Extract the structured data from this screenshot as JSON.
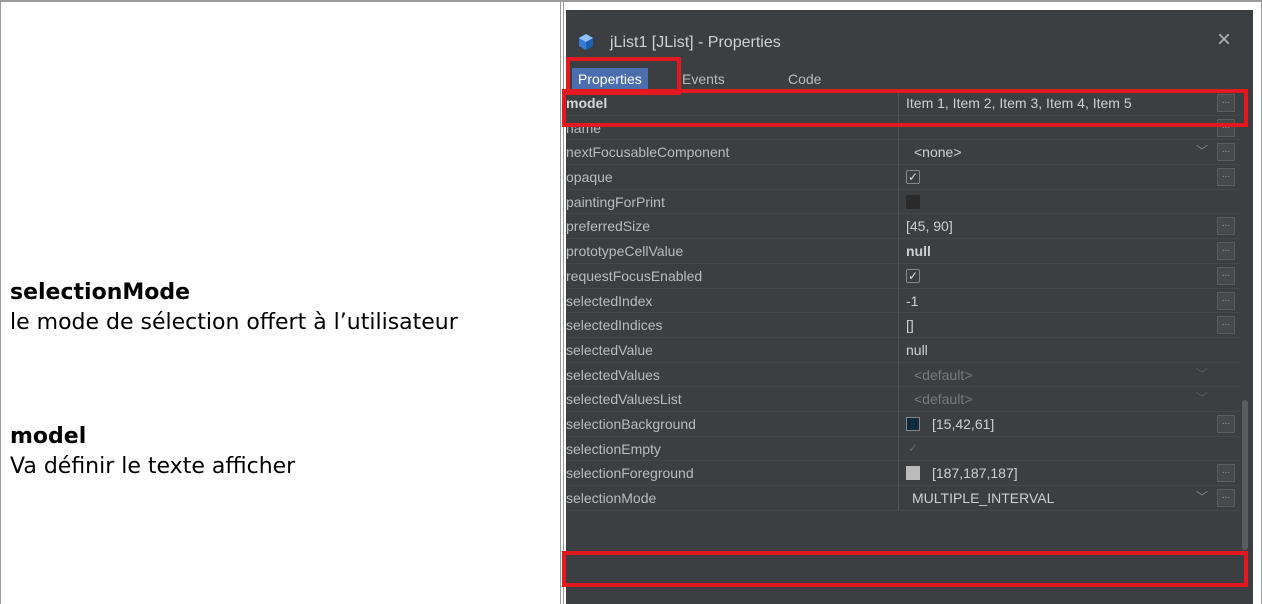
{
  "doc": {
    "heading1": "selectionMode",
    "desc1": "le mode de sélection offert à l’utilisateur",
    "heading2": "model",
    "desc2": "Va définir le texte afficher"
  },
  "window": {
    "title": "jList1 [JList] - Properties",
    "close": "×",
    "tabs": [
      "Properties",
      "Events",
      "Code"
    ]
  },
  "properties": [
    {
      "name": "model",
      "value": "Item 1, Item 2, Item 3, Item 4, Item 5"
    },
    {
      "name": "name",
      "value": ""
    },
    {
      "name": "nextFocusableComponent",
      "value": "<none>"
    },
    {
      "name": "opaque",
      "value": "✓"
    },
    {
      "name": "paintingForPrint",
      "value": ""
    },
    {
      "name": "preferredSize",
      "value": "[45, 90]"
    },
    {
      "name": "prototypeCellValue",
      "value": "null"
    },
    {
      "name": "requestFocusEnabled",
      "value": "✓"
    },
    {
      "name": "selectedIndex",
      "value": "-1"
    },
    {
      "name": "selectedIndices",
      "value": "[]"
    },
    {
      "name": "selectedValue",
      "value": "null"
    },
    {
      "name": "selectedValues",
      "value": "<default>"
    },
    {
      "name": "selectedValuesList",
      "value": "<default>"
    },
    {
      "name": "selectionBackground",
      "value": "[15,42,61]"
    },
    {
      "name": "selectionEmpty",
      "value": "✓"
    },
    {
      "name": "selectionForeground",
      "value": "[187,187,187]"
    },
    {
      "name": "selectionMode",
      "value": "MULTIPLE_INTERVAL"
    }
  ],
  "more_button": "...",
  "dropdown_icon": "chevron-down-icon",
  "colors": {
    "highlight": "#e3191f",
    "selectionBackground": "#0f2a3d",
    "selectionForeground": "#bbbbbb",
    "active_tab": "#4b6eaf",
    "panel": "#3c3f41"
  }
}
